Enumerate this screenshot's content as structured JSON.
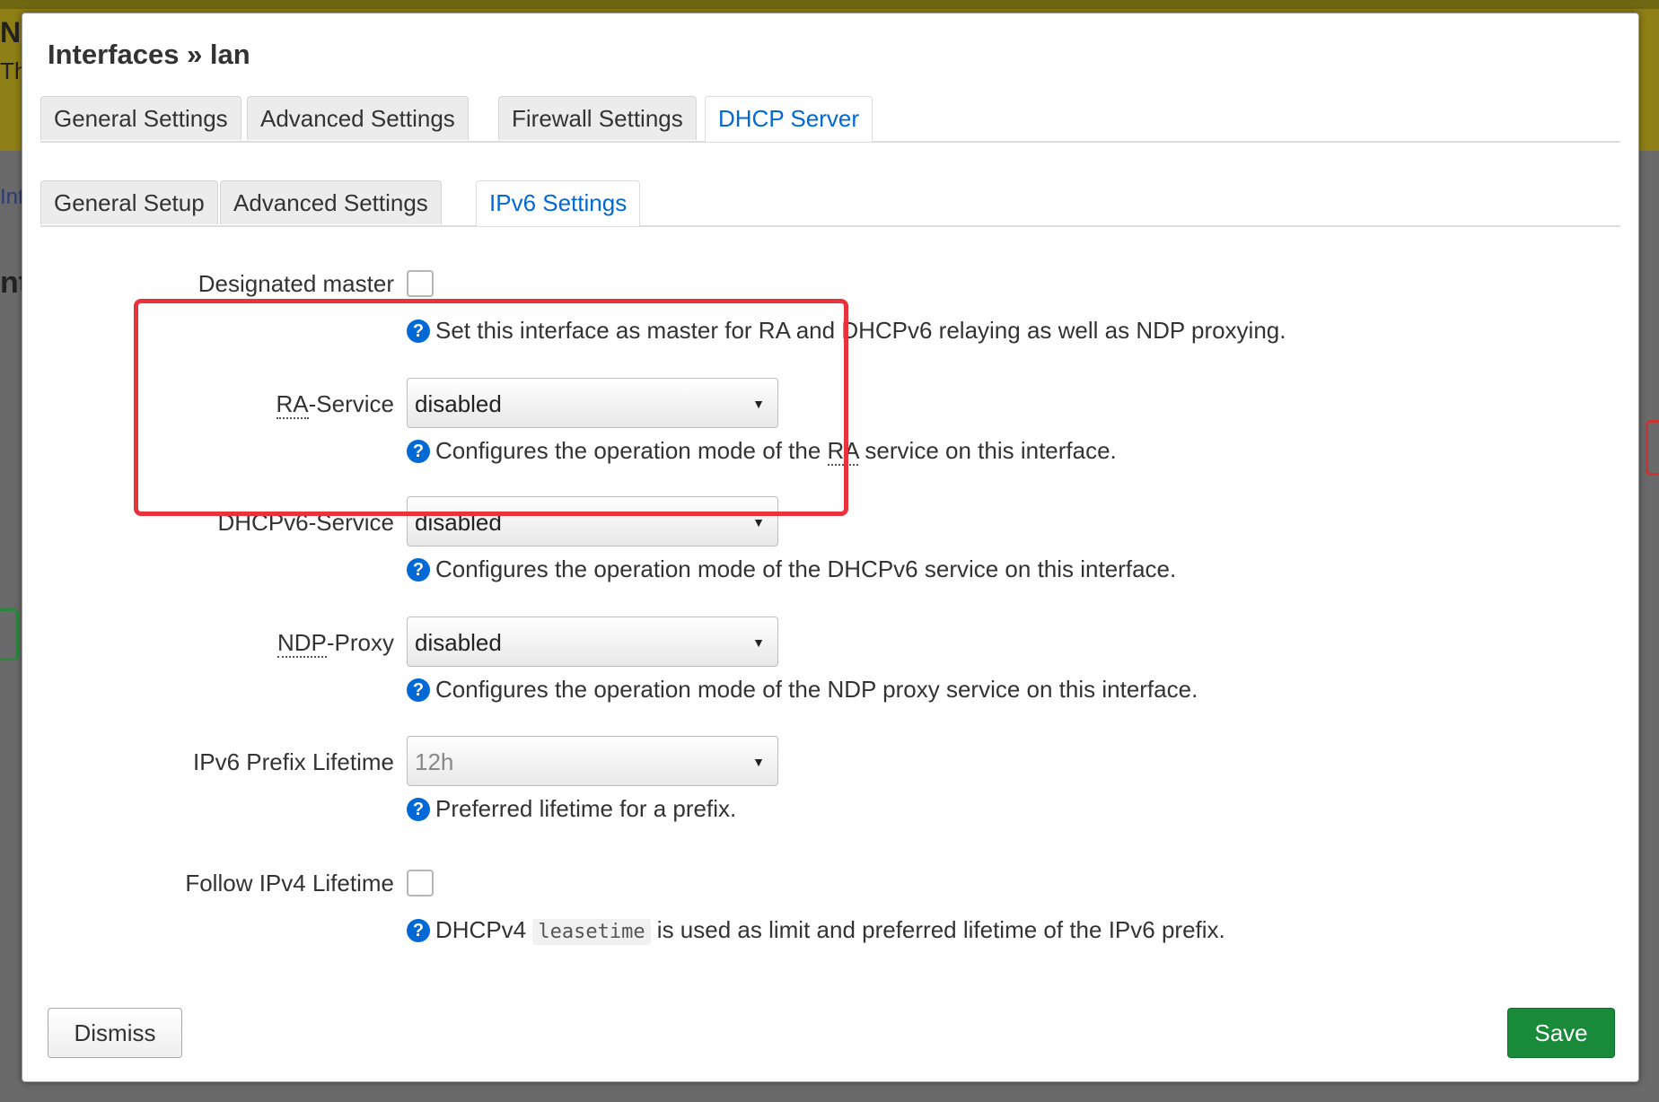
{
  "background": {
    "fragments": [
      "N",
      "Th",
      "Int",
      "nt"
    ]
  },
  "modal": {
    "title": "Interfaces » lan",
    "main_tabs": [
      {
        "label": "General Settings",
        "active": false
      },
      {
        "label": "Advanced Settings",
        "active": false
      },
      {
        "label": "Firewall Settings",
        "active": false
      },
      {
        "label": "DHCP Server",
        "active": true
      }
    ],
    "sub_tabs": [
      {
        "label": "General Setup",
        "active": false
      },
      {
        "label": "Advanced Settings",
        "active": false
      },
      {
        "label": "IPv6 Settings",
        "active": true
      }
    ],
    "fields": {
      "designated_master": {
        "label": "Designated master",
        "checked": false,
        "help": "Set this interface as master for RA and DHCPv6 relaying as well as NDP proxying."
      },
      "ra_service": {
        "label_abbr": "RA",
        "label_rest": "-Service",
        "value": "disabled",
        "help_pre": "Configures the operation mode of the ",
        "help_abbr": "RA",
        "help_post": " service on this interface."
      },
      "dhcpv6_service": {
        "label": "DHCPv6-Service",
        "value": "disabled",
        "help": "Configures the operation mode of the DHCPv6 service on this interface."
      },
      "ndp_proxy": {
        "label_abbr": "NDP",
        "label_rest": "-Proxy",
        "value": "disabled",
        "help": "Configures the operation mode of the NDP proxy service on this interface."
      },
      "ipv6_prefix_lifetime": {
        "label": "IPv6 Prefix Lifetime",
        "value": "12h",
        "help": "Preferred lifetime for a prefix."
      },
      "follow_ipv4_lifetime": {
        "label": "Follow IPv4 Lifetime",
        "checked": false,
        "help_pre": "DHCPv4 ",
        "help_code": "leasetime",
        "help_post": " is used as limit and preferred lifetime of the IPv6 prefix."
      }
    },
    "help_icon_glyph": "?",
    "select_caret_glyph": "▼",
    "buttons": {
      "dismiss": "Dismiss",
      "save": "Save"
    }
  },
  "colors": {
    "accent": "#0069d6",
    "save": "#188a39",
    "highlight": "#e8323c"
  }
}
